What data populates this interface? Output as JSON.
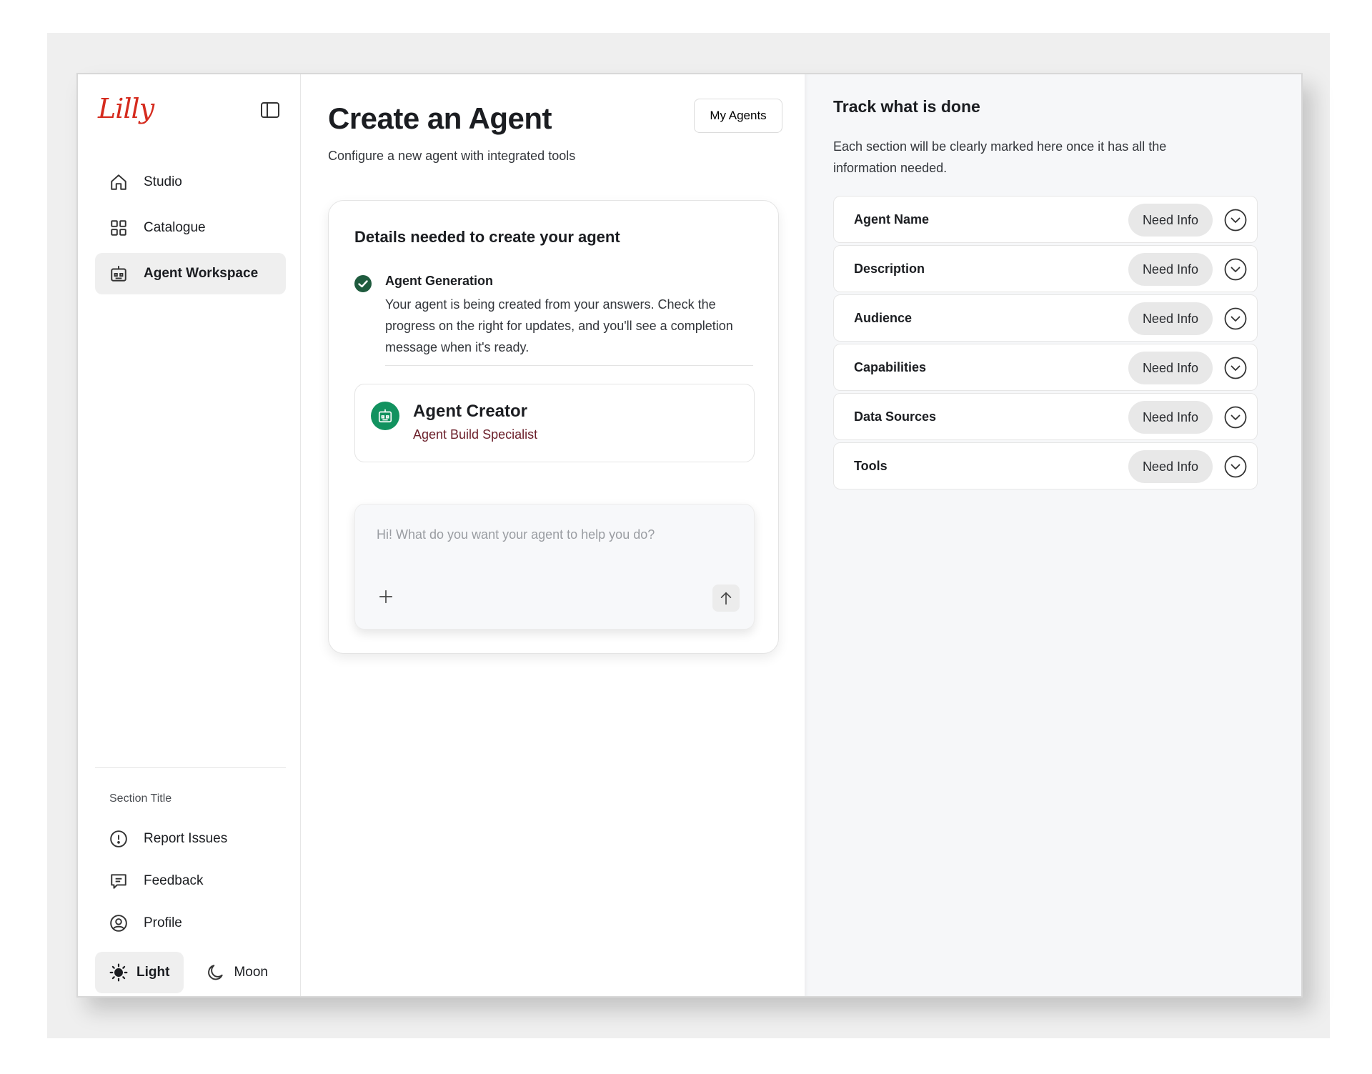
{
  "brand": {
    "logo_text": "Lilly",
    "accent": "#d52b1e",
    "success": "#12925f"
  },
  "sidebar": {
    "collapse_icon": "sidebar-toggle-icon",
    "items": [
      {
        "label": "Studio",
        "icon": "home-icon",
        "active": false
      },
      {
        "label": "Catalogue",
        "icon": "grid-icon",
        "active": false
      },
      {
        "label": "Agent Workspace",
        "icon": "robot-icon",
        "active": true
      }
    ],
    "section_title": "Section Title",
    "bottom_items": [
      {
        "label": "Report Issues",
        "icon": "alert-circle-icon"
      },
      {
        "label": "Feedback",
        "icon": "message-icon"
      },
      {
        "label": "Profile",
        "icon": "user-circle-icon"
      }
    ],
    "theme": {
      "light_label": "Light",
      "moon_label": "Moon",
      "selected": "Light"
    }
  },
  "main": {
    "title": "Create an Agent",
    "subtitle": "Configure a new agent with integrated tools",
    "my_agents_label": "My Agents",
    "details": {
      "heading": "Details needed to create your agent",
      "generation_title": "Agent Generation",
      "generation_text": "Your agent is being created from your answers. Check the progress on the right for updates, and you'll see a completion message when it's ready.",
      "creator_name": "Agent Creator",
      "creator_role": "Agent Build Specialist"
    },
    "chat": {
      "placeholder": "Hi! What do you want your agent to help you do?",
      "value": ""
    }
  },
  "track": {
    "title": "Track what is done",
    "description": "Each section will be clearly marked here once it has all the information needed.",
    "rows": [
      {
        "label": "Agent Name",
        "status": "Need Info"
      },
      {
        "label": "Description",
        "status": "Need Info"
      },
      {
        "label": "Audience",
        "status": "Need Info"
      },
      {
        "label": "Capabilities",
        "status": "Need Info"
      },
      {
        "label": "Data Sources",
        "status": "Need Info"
      },
      {
        "label": "Tools",
        "status": "Need Info"
      }
    ]
  }
}
